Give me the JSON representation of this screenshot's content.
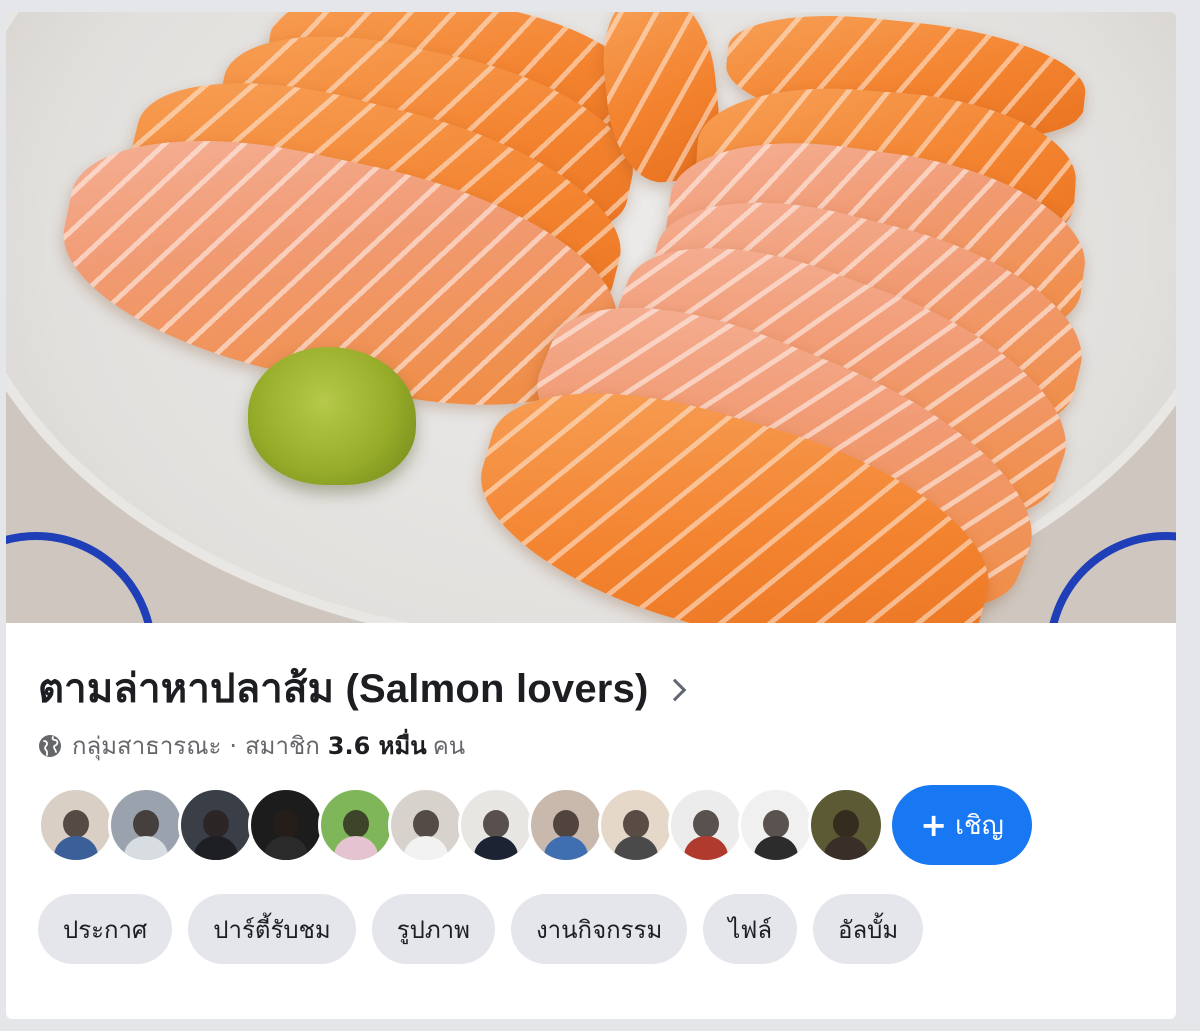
{
  "cover": {
    "description_icon": "salmon-sashimi-photo",
    "colors": {
      "salmon": "#f3832f",
      "plate": "#e2e0dd",
      "rim": "#1f3fb8",
      "wasabi": "#97ad2a"
    }
  },
  "group": {
    "title": "ตามล่าหาปลาส้ม (Salmon lovers)",
    "privacy": "กลุ่มสาธารณะ",
    "separator": "·",
    "members_label": "สมาชิก",
    "members_count": "3.6 หมื่น",
    "members_unit": "คน"
  },
  "members": {
    "avatars": [
      {
        "name": "member-1",
        "bg": "#d9cfc4",
        "body": "#3b5f99"
      },
      {
        "name": "member-2",
        "bg": "#9aa3ad",
        "body": "#d8dde2"
      },
      {
        "name": "member-3",
        "bg": "#3a3f47",
        "body": "#1d1f24"
      },
      {
        "name": "member-4",
        "bg": "#1c1c1c",
        "body": "#2a2a2a"
      },
      {
        "name": "member-5",
        "bg": "#7fb65a",
        "body": "#e6c3d1"
      },
      {
        "name": "member-6",
        "bg": "#d8d2cc",
        "body": "#f2f2f2"
      },
      {
        "name": "member-7",
        "bg": "#e8e6e3",
        "body": "#1c2433"
      },
      {
        "name": "member-8",
        "bg": "#c9b9ad",
        "body": "#3f6fb0"
      },
      {
        "name": "member-9",
        "bg": "#e6d8c8",
        "body": "#4a4a4a"
      },
      {
        "name": "member-10",
        "bg": "#ececec",
        "body": "#b03a2e"
      },
      {
        "name": "member-11",
        "bg": "#f0f0f0",
        "body": "#2c2c2c"
      },
      {
        "name": "member-12",
        "bg": "#5b5a35",
        "body": "#3a2f28"
      }
    ],
    "invite_plus": "+",
    "invite_label": "เชิญ"
  },
  "tabs": [
    {
      "id": "announcements",
      "label": "ประกาศ"
    },
    {
      "id": "watch-party",
      "label": "ปาร์ตี้รับชม"
    },
    {
      "id": "photos",
      "label": "รูปภาพ"
    },
    {
      "id": "events",
      "label": "งานกิจกรรม"
    },
    {
      "id": "files",
      "label": "ไฟล์"
    },
    {
      "id": "albums",
      "label": "อัลบั้ม"
    }
  ],
  "accent_color": "#1877f2"
}
